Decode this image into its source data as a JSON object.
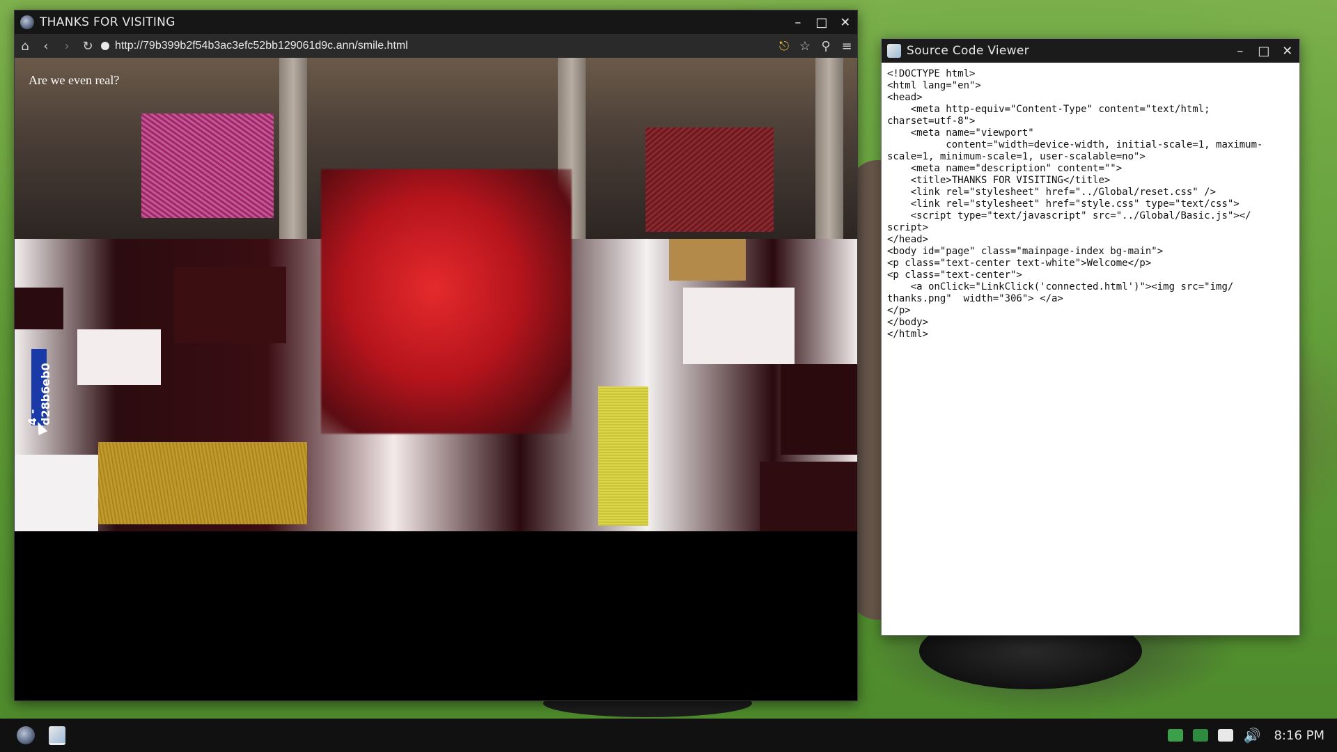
{
  "browser": {
    "title": "THANKS FOR VISITING",
    "url": "http://79b399b2f54b3ac3efc52bb129061d9c.ann/smile.html",
    "page_text": "Are we even real?",
    "vertical_tag": "4 - d28b6eb0"
  },
  "viewer": {
    "title": "Source Code Viewer",
    "code": "<!DOCTYPE html>\n<html lang=\"en\">\n<head>\n    <meta http-equiv=\"Content-Type\" content=\"text/html;\ncharset=utf-8\">\n    <meta name=\"viewport\"\n          content=\"width=device-width, initial-scale=1, maximum-\nscale=1, minimum-scale=1, user-scalable=no\">\n    <meta name=\"description\" content=\"\">\n    <title>THANKS FOR VISITING</title>\n    <link rel=\"stylesheet\" href=\"../Global/reset.css\" />\n    <link rel=\"stylesheet\" href=\"style.css\" type=\"text/css\">\n    <script type=\"text/javascript\" src=\"../Global/Basic.js\"></\nscript>\n</head>\n<body id=\"page\" class=\"mainpage-index bg-main\">\n<p class=\"text-center text-white\">Welcome</p>\n<p class=\"text-center\">\n    <a onClick=\"LinkClick('connected.html')\"><img src=\"img/\nthanks.png\"  width=\"306\"> </a>\n</p>\n</body>\n</html>"
  },
  "taskbar": {
    "clock": "8:16 PM"
  },
  "icons": {
    "home": "home-icon",
    "back": "back-icon",
    "forward": "forward-icon",
    "reload": "reload-icon",
    "key": "key-icon",
    "star": "star-icon",
    "zoom": "zoom-icon",
    "menu": "menu-icon"
  }
}
